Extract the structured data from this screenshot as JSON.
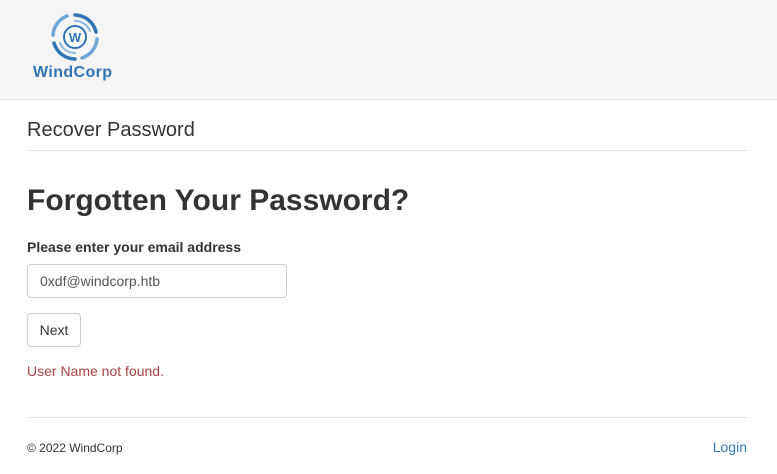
{
  "brand": {
    "name": "WindCorp",
    "logo_letter": "W",
    "color": "#2f74b5"
  },
  "page": {
    "section_title": "Recover Password",
    "heading": "Forgotten Your Password?"
  },
  "form": {
    "email_label": "Please enter your email address",
    "email_value": "0xdf@windcorp.htb",
    "next_label": "Next",
    "error_message": "User Name not found.",
    "error_color": "#a94442"
  },
  "footer": {
    "copyright": "© 2022 WindCorp",
    "login_label": "Login",
    "link_color": "#337ab7"
  }
}
